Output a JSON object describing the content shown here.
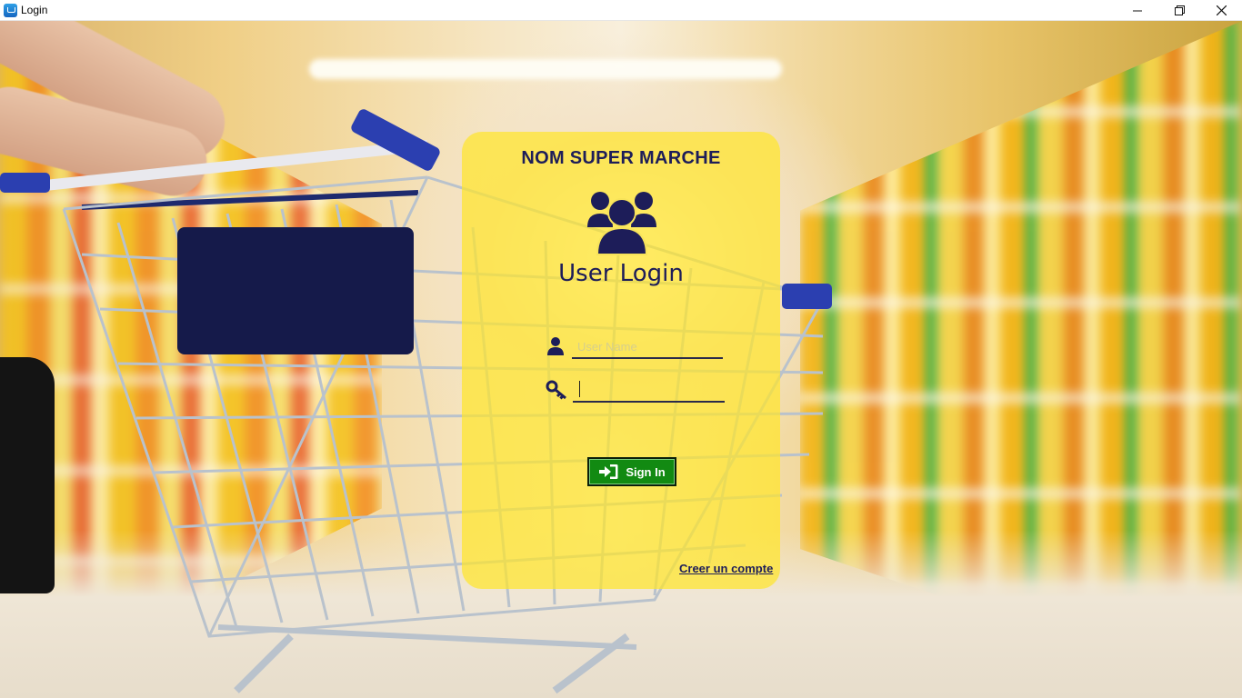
{
  "window": {
    "title": "Login",
    "icon": "app-cart-icon",
    "controls": [
      "minimize-icon",
      "restore-icon",
      "close-icon"
    ]
  },
  "login": {
    "brand": "NOM SUPER MARCHE",
    "heading": "User Login",
    "header_icon": "users-group-icon",
    "username": {
      "icon": "user-icon",
      "placeholder": "User Name",
      "value": ""
    },
    "password": {
      "icon": "key-icon",
      "value": ""
    },
    "sign_in_label": "Sign In",
    "sign_in_icon": "sign-in-icon",
    "create_account_label": "Creer un compte"
  },
  "colors": {
    "panel": "#FFE628",
    "brand_text": "#1D1D59",
    "sign_in_bg": "#128A12"
  }
}
